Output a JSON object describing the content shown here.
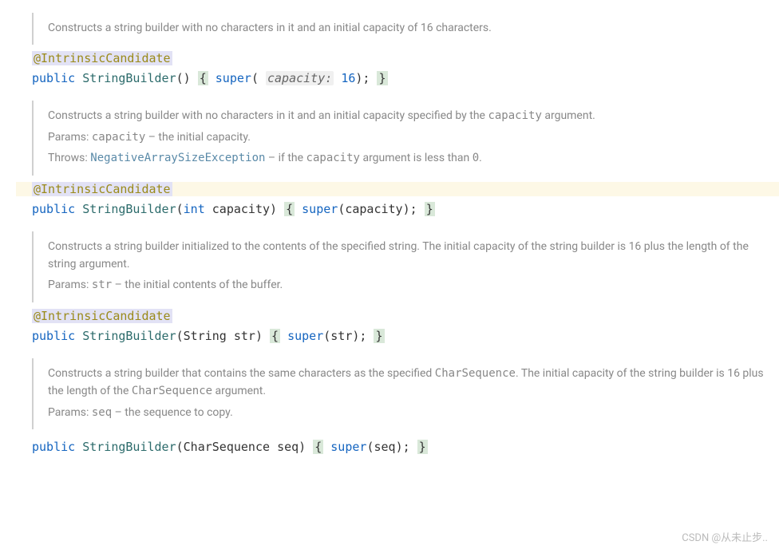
{
  "blocks": [
    {
      "doc": {
        "main": "Constructs a string builder with no characters in it and an initial capacity of 16 characters."
      },
      "annotation": "@IntrinsicCandidate",
      "code": {
        "kw1": "public",
        "type": "StringBuilder",
        "params_open": "()",
        "lbrace": "{",
        "kw2": "super",
        "hint": "capacity:",
        "arg": "16",
        "close": ");",
        "rbrace": "}"
      },
      "highlight": false
    },
    {
      "doc": {
        "main": "Constructs a string builder with no characters in it and an initial capacity specified by the capacity argument.",
        "main_mono1": "capacity",
        "params_label": "Params:",
        "params_name": "capacity",
        "params_desc": "– the initial capacity.",
        "throws_label": "Throws:",
        "throws_type": "NegativeArraySizeException",
        "throws_desc_pre": "– if the",
        "throws_mono": "capacity",
        "throws_desc_post": "argument is less than",
        "throws_val": "0"
      },
      "annotation": "@IntrinsicCandidate",
      "code": {
        "kw1": "public",
        "type": "StringBuilder",
        "param_type": "int",
        "param_name": "capacity",
        "lbrace": "{",
        "kw2": "super",
        "arg": "capacity",
        "close": ");",
        "rbrace": "}"
      },
      "highlight": true
    },
    {
      "doc": {
        "main": "Constructs a string builder initialized to the contents of the specified string. The initial capacity of the string builder is 16 plus the length of the string argument.",
        "params_label": "Params:",
        "params_name": "str",
        "params_desc": "– the initial contents of the buffer."
      },
      "annotation": "@IntrinsicCandidate",
      "code": {
        "kw1": "public",
        "type": "StringBuilder",
        "param_type": "String",
        "param_name": "str",
        "lbrace": "{",
        "kw2": "super",
        "arg": "str",
        "close": ");",
        "rbrace": "}"
      },
      "highlight": false
    },
    {
      "doc": {
        "main_pre": "Constructs a string builder that contains the same characters as the specified",
        "main_mono1": "CharSequence",
        "main_mid": ". The initial capacity of the string builder is 16 plus the length of the",
        "main_mono2": "CharSequence",
        "main_post": "argument.",
        "params_label": "Params:",
        "params_name": "seq",
        "params_desc": "– the sequence to copy."
      },
      "code": {
        "kw1": "public",
        "type": "StringBuilder",
        "param_type": "CharSequence",
        "param_name": "seq",
        "lbrace": "{",
        "kw2": "super",
        "arg": "seq",
        "close": ");",
        "rbrace": "}"
      },
      "highlight": false
    }
  ],
  "watermark": "CSDN @从未止步.."
}
